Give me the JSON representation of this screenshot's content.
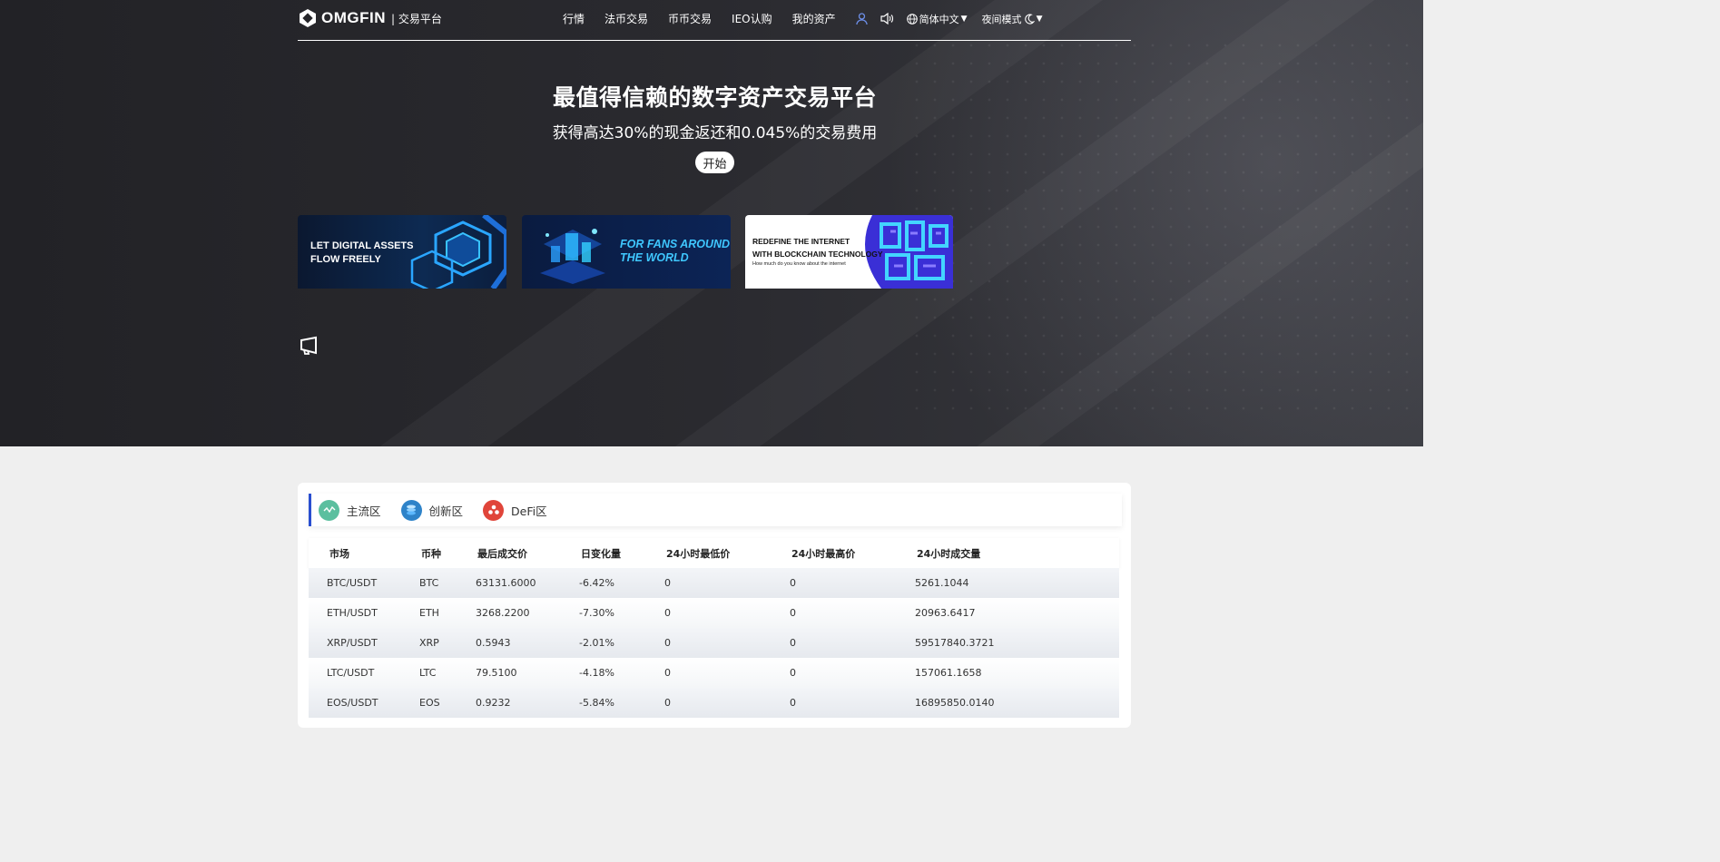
{
  "nav": {
    "logo_text": "OMGFIN",
    "logo_sub": "| 交易平台",
    "links": [
      "行情",
      "法币交易",
      "币币交易",
      "IEO认购",
      "我的资产"
    ],
    "language": "简体中文",
    "mode": "夜间模式"
  },
  "hero": {
    "title": "最值得信赖的数字资产交易平台",
    "subtitle": "获得高达30%的现金返还和0.045%的交易费用",
    "start_label": "开始"
  },
  "banners": [
    {
      "text": "LET DIGITAL ASSETS\nFLOW FREELY"
    },
    {
      "text": "FOR FANS AROUND\nTHE WORLD"
    },
    {
      "text": "REDEFINE THE INTERNET\nWITH BLOCKCHAIN TECHNOLOGY",
      "subtext": "How much do you know about the internet"
    }
  ],
  "market": {
    "tabs": [
      {
        "label": "主流区",
        "icon": "wave-icon",
        "color": "#5bbf9f"
      },
      {
        "label": "创新区",
        "icon": "coin-stack-icon",
        "color": "#2e83c9"
      },
      {
        "label": "DeFi区",
        "icon": "defi-icon",
        "color": "#e0453a"
      }
    ],
    "columns": [
      "市场",
      "币种",
      "最后成交价",
      "日变化量",
      "24小时最低价",
      "24小时最高价",
      "24小时成交量"
    ],
    "rows": [
      {
        "market": "BTC/USDT",
        "coin": "BTC",
        "last": "63131.6000",
        "change": "-6.42%",
        "low": "0",
        "high": "0",
        "volume": "5261.1044"
      },
      {
        "market": "ETH/USDT",
        "coin": "ETH",
        "last": "3268.2200",
        "change": "-7.30%",
        "low": "0",
        "high": "0",
        "volume": "20963.6417"
      },
      {
        "market": "XRP/USDT",
        "coin": "XRP",
        "last": "0.5943",
        "change": "-2.01%",
        "low": "0",
        "high": "0",
        "volume": "59517840.3721"
      },
      {
        "market": "LTC/USDT",
        "coin": "LTC",
        "last": "79.5100",
        "change": "-4.18%",
        "low": "0",
        "high": "0",
        "volume": "157061.1658"
      },
      {
        "market": "EOS/USDT",
        "coin": "EOS",
        "last": "0.9232",
        "change": "-5.84%",
        "low": "0",
        "high": "0",
        "volume": "16895850.0140"
      }
    ]
  },
  "colors": {
    "accent": "#2a4fd0",
    "hero_bg": "#26262a"
  }
}
